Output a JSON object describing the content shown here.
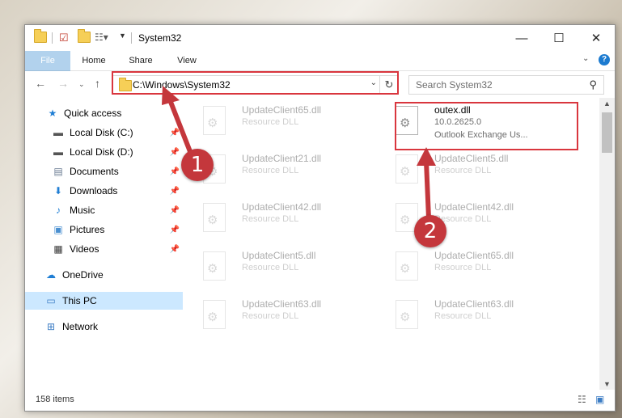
{
  "window": {
    "title": "System32"
  },
  "ribbon": {
    "file": "File",
    "home": "Home",
    "share": "Share",
    "view": "View"
  },
  "address": {
    "path": "C:\\Windows\\System32"
  },
  "search": {
    "placeholder": "Search System32"
  },
  "sidebar": {
    "items": [
      {
        "label": "Quick access"
      },
      {
        "label": "Local Disk (C:)"
      },
      {
        "label": "Local Disk (D:)"
      },
      {
        "label": "Documents"
      },
      {
        "label": "Downloads"
      },
      {
        "label": "Music"
      },
      {
        "label": "Pictures"
      },
      {
        "label": "Videos"
      },
      {
        "label": "OneDrive"
      },
      {
        "label": "This PC"
      },
      {
        "label": "Network"
      }
    ]
  },
  "files": [
    {
      "name": "UpdateClient65.dll",
      "sub": "Resource DLL"
    },
    {
      "name": "outex.dll",
      "version": "10.0.2625.0",
      "desc": "Outlook Exchange Us..."
    },
    {
      "name": "UpdateClient21.dll",
      "sub": "Resource DLL"
    },
    {
      "name": "UpdateClient5.dll",
      "sub": "Resource DLL"
    },
    {
      "name": "UpdateClient42.dll",
      "sub": "Resource DLL"
    },
    {
      "name": "UpdateClient42.dll",
      "sub": "Resource DLL"
    },
    {
      "name": "UpdateClient5.dll",
      "sub": "Resource DLL"
    },
    {
      "name": "UpdateClient65.dll",
      "sub": "Resource DLL"
    },
    {
      "name": "UpdateClient63.dll",
      "sub": "Resource DLL"
    },
    {
      "name": "UpdateClient63.dll",
      "sub": "Resource DLL"
    }
  ],
  "status": {
    "count": "158 items"
  },
  "annotations": {
    "step1": "1",
    "step2": "2"
  },
  "colors": {
    "accent": "#1979ca",
    "highlight": "#d9363e",
    "selected": "#cce8ff"
  }
}
